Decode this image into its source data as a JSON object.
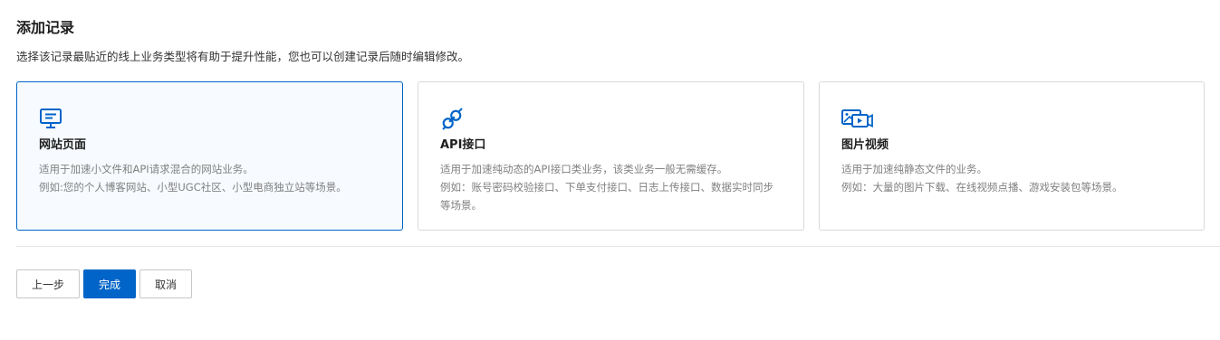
{
  "header": {
    "title": "添加记录",
    "subtitle": "选择该记录最贴近的线上业务类型将有助于提升性能，您也可以创建记录后随时编辑修改。"
  },
  "cards": [
    {
      "icon": "monitor-icon",
      "title": "网站页面",
      "desc_line1": "适用于加速小文件和API请求混合的网站业务。",
      "desc_line2": "例如:您的个人博客网站、小型UGC社区、小型电商独立站等场景。",
      "selected": true
    },
    {
      "icon": "api-link-icon",
      "title": "API接口",
      "desc_line1": "适用于加速纯动态的API接口类业务，该类业务一般无需缓存。",
      "desc_line2": "例如：账号密码校验接口、下单支付接口、日志上传接口、数据实时同步等场景。",
      "selected": false
    },
    {
      "icon": "image-video-icon",
      "title": "图片视频",
      "desc_line1": "适用于加速纯静态文件的业务。",
      "desc_line2": "例如：大量的图片下载、在线视频点播、游戏安装包等场景。",
      "selected": false
    }
  ],
  "footer": {
    "prev_label": "上一步",
    "done_label": "完成",
    "cancel_label": "取消"
  },
  "colors": {
    "accent": "#0064c8",
    "selected_bg": "#f7fbff",
    "border": "#d9d9d9"
  }
}
